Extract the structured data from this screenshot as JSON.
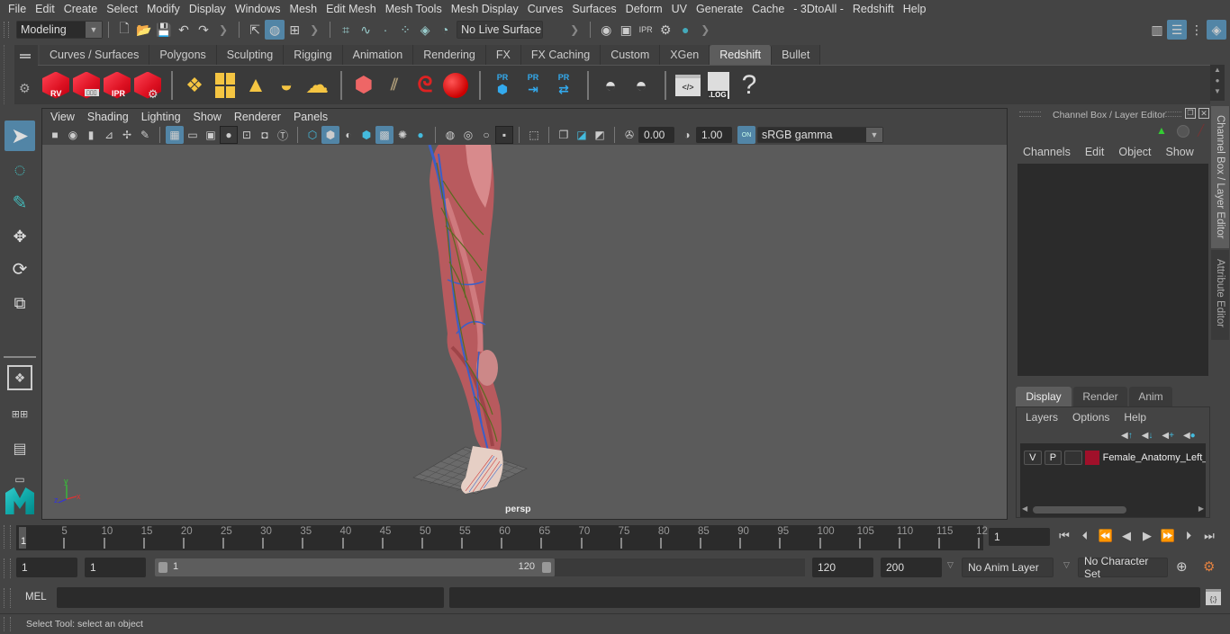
{
  "menubar": {
    "items": [
      "File",
      "Edit",
      "Create",
      "Select",
      "Modify",
      "Display",
      "Windows",
      "Mesh",
      "Edit Mesh",
      "Mesh Tools",
      "Mesh Display",
      "Curves",
      "Surfaces",
      "Deform",
      "UV",
      "Generate",
      "Cache",
      "- 3DtoAll -",
      "Redshift",
      "Help"
    ]
  },
  "statusline": {
    "menuset": "Modeling",
    "live_surface": "No Live Surface"
  },
  "shelf": {
    "tabs": [
      "Curves / Surfaces",
      "Polygons",
      "Sculpting",
      "Rigging",
      "Animation",
      "Rendering",
      "FX",
      "FX Caching",
      "Custom",
      "XGen",
      "Redshift",
      "Bullet"
    ],
    "active_tab": "Redshift",
    "buttons": {
      "rv": "RV",
      "ipr": "IPR",
      "pr": "PR",
      "log": ".LOG",
      "help": "?"
    }
  },
  "viewport": {
    "menus": [
      "View",
      "Shading",
      "Lighting",
      "Show",
      "Renderer",
      "Panels"
    ],
    "exposure": "0.00",
    "gamma": "1.00",
    "color_mgmt_on": "ON",
    "color_space": "sRGB gamma",
    "camera_label": "persp",
    "axis": {
      "x": "x",
      "y": "y",
      "z": "z"
    }
  },
  "channel_box": {
    "title": "Channel Box / Layer Editor",
    "menus": [
      "Channels",
      "Edit",
      "Object",
      "Show"
    ],
    "layer_tabs": [
      "Display",
      "Render",
      "Anim"
    ],
    "active_layer_tab": "Display",
    "layer_menus": [
      "Layers",
      "Options",
      "Help"
    ],
    "layers": [
      {
        "v": "V",
        "p": "P",
        "color": "#a0102a",
        "name": "Female_Anatomy_Left_"
      }
    ]
  },
  "side_tabs": [
    "Channel Box / Layer Editor",
    "Attribute Editor"
  ],
  "timeline": {
    "ticks": [
      "5",
      "10",
      "15",
      "20",
      "25",
      "30",
      "35",
      "40",
      "45",
      "50",
      "55",
      "60",
      "65",
      "70",
      "75",
      "80",
      "85",
      "90",
      "95",
      "100",
      "105",
      "110",
      "115",
      "12"
    ],
    "current_frame_marker": "1",
    "current_frame": "1"
  },
  "range": {
    "start": "1",
    "playback_start": "1",
    "slider_start": "1",
    "slider_end": "120",
    "playback_end": "120",
    "end": "200",
    "anim_layer": "No Anim Layer",
    "character_set": "No Character Set"
  },
  "command_line": {
    "label": "MEL"
  },
  "help_line": {
    "text": "Select Tool: select an object"
  }
}
